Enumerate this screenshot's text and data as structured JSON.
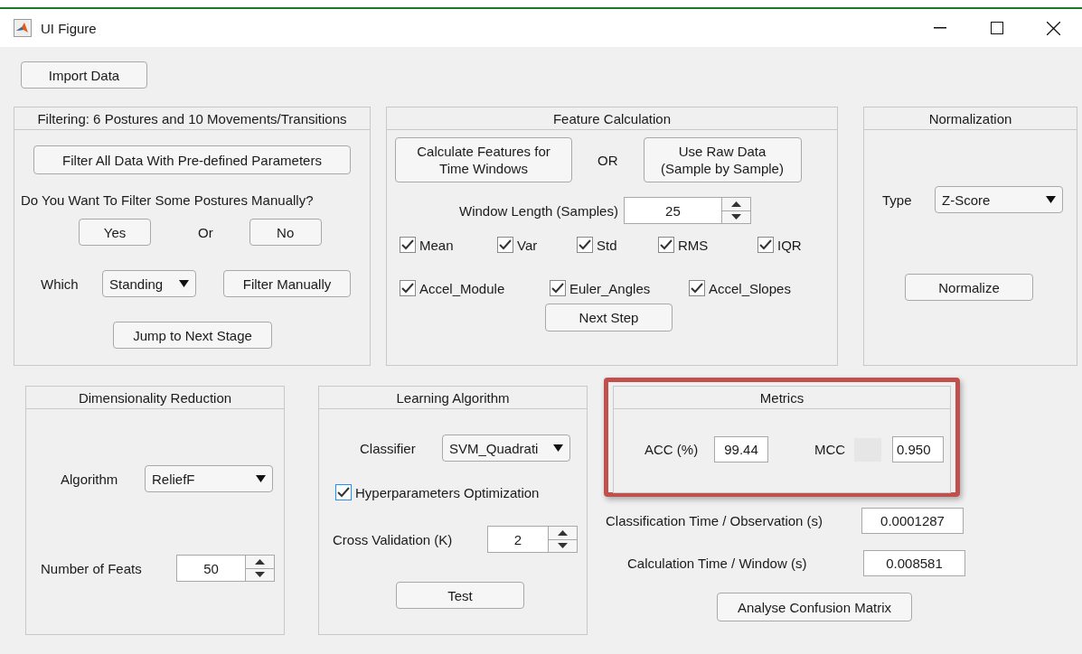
{
  "window": {
    "title": "UI Figure"
  },
  "import_button": "Import Data",
  "filtering": {
    "title": "Filtering: 6 Postures and 10 Movements/Transitions",
    "filter_all_button": "Filter All Data With Pre-defined Parameters",
    "question": "Do You Want To Filter Some Postures Manually?",
    "yes_button": "Yes",
    "or_label": "Or",
    "no_button": "No",
    "which_label": "Which",
    "posture_dropdown": "Standing",
    "filter_manually_button": "Filter Manually",
    "jump_button": "Jump to Next Stage"
  },
  "feature_calculation": {
    "title": "Feature Calculation",
    "calculate_button": "Calculate Features for\nTime Windows",
    "or_label": "OR",
    "raw_button": "Use Raw Data\n(Sample by Sample)",
    "window_length_label": "Window Length (Samples)",
    "window_length_value": "25",
    "statistics": [
      {
        "label": "Mean",
        "checked": true
      },
      {
        "label": "Var",
        "checked": true
      },
      {
        "label": "Std",
        "checked": true
      },
      {
        "label": "RMS",
        "checked": true
      },
      {
        "label": "IQR",
        "checked": true
      }
    ],
    "signals": [
      {
        "label": "Accel_Module",
        "checked": true
      },
      {
        "label": "Euler_Angles",
        "checked": true
      },
      {
        "label": "Accel_Slopes",
        "checked": true
      }
    ],
    "next_button": "Next Step"
  },
  "normalization": {
    "title": "Normalization",
    "type_label": "Type",
    "type_dropdown": "Z-Score",
    "normalize_button": "Normalize"
  },
  "dimensionality_reduction": {
    "title": "Dimensionality Reduction",
    "algorithm_label": "Algorithm",
    "algorithm_dropdown": "ReliefF",
    "feats_label": "Number of Feats",
    "feats_value": "50"
  },
  "learning_algorithm": {
    "title": "Learning Algorithm",
    "classifier_label": "Classifier",
    "classifier_dropdown": "SVM_Quadrati",
    "hyperparameters": {
      "label": "Hyperparameters Optimization",
      "checked": true,
      "focused": true
    },
    "cv_label": "Cross Validation (K)",
    "cv_value": "2",
    "test_button": "Test"
  },
  "metrics": {
    "title": "Metrics",
    "highlighted": true,
    "acc_label": "ACC (%)",
    "acc_value": "99.44",
    "mcc_label": "MCC",
    "mcc_value": "0.950"
  },
  "timings": [
    {
      "label": "Classification Time / Observation (s)",
      "value": "0.0001287"
    },
    {
      "label": "Calculation Time / Window (s)",
      "value": "0.008581"
    }
  ],
  "confusion_button": "Analyse Confusion Matrix"
}
